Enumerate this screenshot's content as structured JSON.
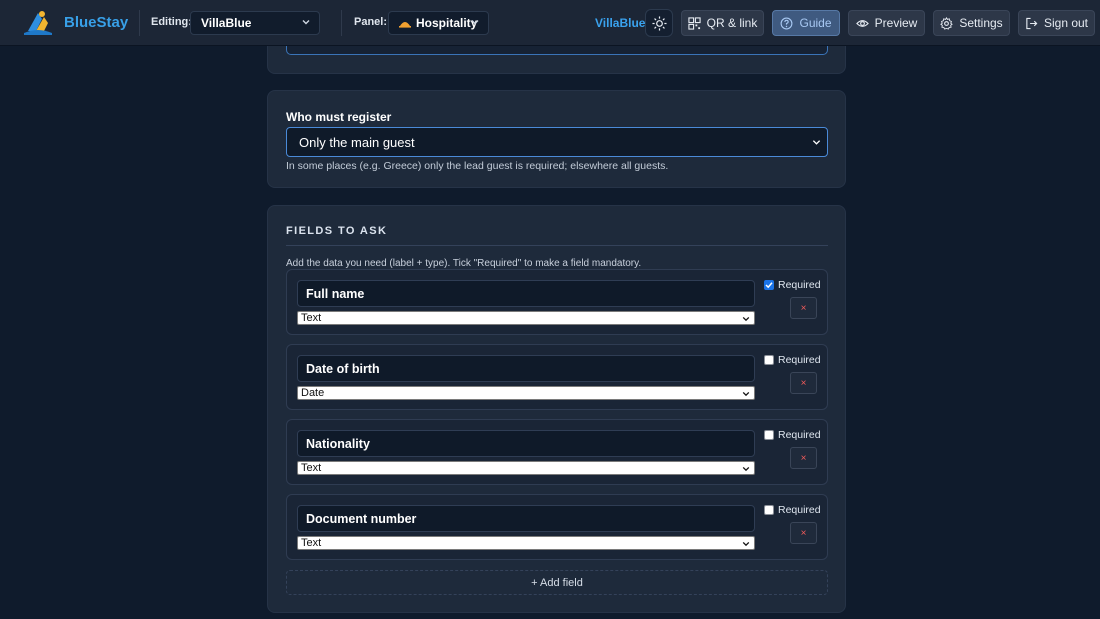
{
  "header": {
    "brand": "BlueStay",
    "editing_label": "Editing:",
    "editing_value": "VillaBlue",
    "panel_label": "Panel:",
    "panel_value": "Hospitality",
    "property_name": "VillaBlue",
    "buttons": {
      "qr": "QR & link",
      "guide": "Guide",
      "preview": "Preview",
      "settings": "Settings",
      "signout": "Sign out"
    }
  },
  "register": {
    "label": "Who must register",
    "selected": "Only the main guest",
    "hint": "In some places (e.g. Greece) only the lead guest is required; elsewhere all guests."
  },
  "fields_section": {
    "title": "FIELDS TO ASK",
    "hint": "Add the data you need (label + type). Tick \"Required\" to make a field mandatory.",
    "required_label": "Required",
    "delete_symbol": "×",
    "add_label": "+ Add field",
    "fields": [
      {
        "name": "Full name",
        "type": "Text",
        "required": true
      },
      {
        "name": "Date of birth",
        "type": "Date",
        "required": false
      },
      {
        "name": "Nationality",
        "type": "Text",
        "required": false
      },
      {
        "name": "Document number",
        "type": "Text",
        "required": false
      }
    ]
  },
  "colors": {
    "accent": "#38a0e8",
    "background": "#0f1b2c",
    "card": "#1e2a3b",
    "delete": "#f05a5a"
  },
  "icons": {
    "logo": "bluestay-logo-icon",
    "theme": "sun-icon",
    "qr": "qr-grid-icon",
    "guide": "help-circle-icon",
    "preview": "eye-icon",
    "settings": "gear-icon",
    "signout": "logout-icon",
    "panel": "hospitality-bell-icon"
  }
}
